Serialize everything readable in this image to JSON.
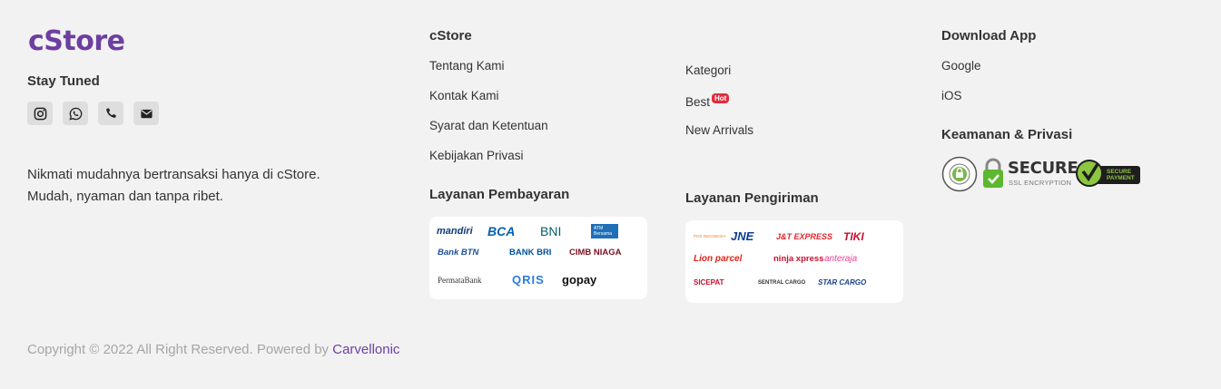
{
  "brand": {
    "logo": "cStore",
    "stay_tuned": "Stay Tuned",
    "tagline_1": "Nikmati mudahnya bertransaksi hanya di cStore.",
    "tagline_2": "Mudah, nyaman dan tanpa ribet."
  },
  "socials": [
    "instagram-icon",
    "whatsapp-icon",
    "phone-icon",
    "envelope-icon"
  ],
  "col_cstore": {
    "heading": "cStore",
    "links": [
      "Tentang Kami",
      "Kontak Kami",
      "Syarat dan Ketentuan",
      "Kebijakan Privasi"
    ]
  },
  "col_shop": {
    "links": [
      "Kategori",
      "Best",
      "New Arrivals"
    ],
    "hot_badge": "Hot"
  },
  "col_app": {
    "heading": "Download App",
    "links": [
      "Google",
      "iOS"
    ],
    "security_heading": "Keamanan & Privasi",
    "secure_big": "SECURE",
    "secure_small": "SSL ENCRYPTION",
    "secure_payment_1": "SECURE",
    "secure_payment_2": "PAYMENT"
  },
  "payment": {
    "heading": "Layanan Pembayaran",
    "logos": [
      "mandiri",
      "BCA",
      "BNI",
      "ATM Bersama",
      "Bank BTN",
      "BANK BRI",
      "CIMB NIAGA",
      "PermataBank",
      "QRIS",
      "gopay"
    ]
  },
  "shipping": {
    "heading": "Layanan Pengiriman",
    "logos": [
      "POS INDONESIA",
      "JNE",
      "J&T EXPRESS",
      "TIKI",
      "Lion parcel",
      "ninja xpress",
      "anteraja",
      "SICEPAT",
      "SENTRAL CARGO",
      "STAR CARGO"
    ]
  },
  "footer": {
    "copyright": "Copyright © 2022 All Right Reserved. Powered by ",
    "powered_by": "Carvellonic"
  },
  "colors": {
    "brand": "#6d3fa0",
    "background": "#f2f2f2",
    "hot": "#e02d3c"
  }
}
